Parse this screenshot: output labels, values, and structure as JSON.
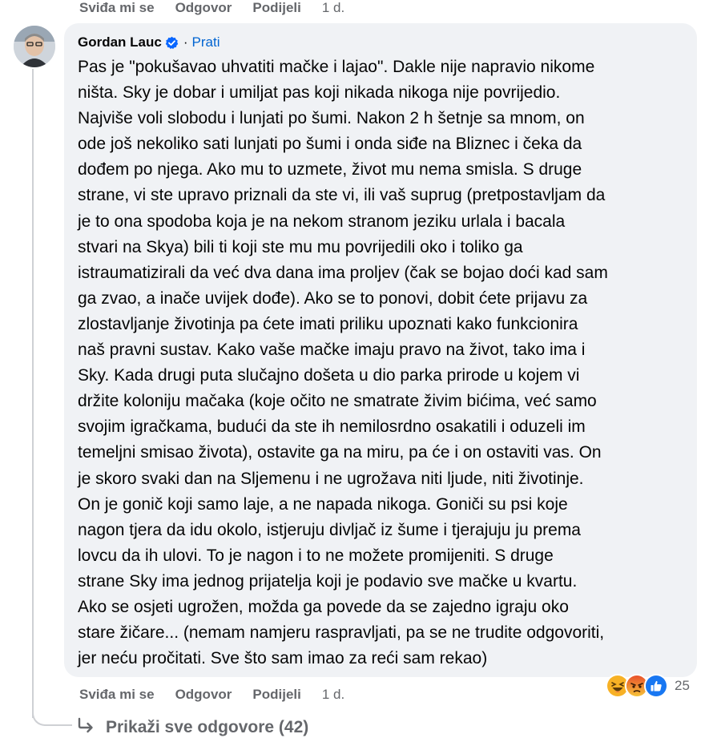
{
  "top_actions": {
    "like": "Sviđa mi se",
    "reply": "Odgovor",
    "share": "Podijeli",
    "time": "1 d."
  },
  "comment": {
    "author": "Gordan Lauc",
    "separator": "·",
    "follow": "Prati",
    "lines": [
      "Pas je \"pokušavao uhvatiti mačke i lajao\". Dakle nije napravio nikome",
      "ništa. Sky je dobar i umiljat pas koji nikada nikoga nije povrijedio.",
      "Najviše voli slobodu i lunjati po šumi. Nakon 2 h šetnje sa mnom, on",
      "ode još nekoliko sati lunjati po šumi i onda siđe na Bliznec i čeka da",
      "dođem po njega. Ako mu to uzmete, život mu nema smisla. S druge",
      "strane, vi ste upravo priznali da ste vi, ili vaš suprug (pretpostavljam da",
      "je to ona spodoba koja je na nekom stranom jeziku urlala i bacala",
      "stvari na Skya) bili ti koji ste mu mu povrijedili oko i toliko ga",
      "istraumatizirali da već dva dana ima proljev (čak se bojao doći kad sam",
      "ga zvao, a inače uvijek dođe). Ako se to ponovi, dobit ćete prijavu za",
      "zlostavljanje životinja pa ćete imati priliku upoznati kako funkcionira",
      "naš pravni sustav. Kako vaše mačke imaju pravo na život, tako ima i",
      "Sky. Kada drugi puta slučajno došeta u dio parka prirode u kojem vi",
      "držite koloniju mačaka (koje očito ne smatrate živim bićima, već samo",
      "svojim igračkama, budući da ste ih nemilosrdno osakatili i oduzeli im",
      "temeljni smisao života), ostavite ga na miru, pa će i on ostaviti vas. On",
      "je skoro svaki dan na Sljemenu i ne ugrožava niti ljude, niti životinje.",
      "On je gonič koji samo laje, a ne napada nikoga. Goniči su psi koje",
      "nagon tjera da idu okolo, istjeruju divljač iz šume i tjerajuju ju prema",
      "lovcu da ih ulovi. To je nagon i to ne možete promijeniti. S druge",
      "strane Sky ima jednog prijatelja koji je podavio sve mačke u kvartu.",
      "Ako se osjeti ugrožen, možda ga povede da se zajedno igraju oko",
      "stare žičare... (nemam namjeru raspravljati, pa se ne trudite odgovoriti,",
      "jer neću pročitati. Sve što sam imao za reći sam rekao)"
    ]
  },
  "bottom_actions": {
    "like": "Sviđa mi se",
    "reply": "Odgovor",
    "share": "Podijeli",
    "time": "1 d."
  },
  "reactions": {
    "icons": [
      "haha-icon",
      "angry-icon",
      "like-icon"
    ],
    "count": "25"
  },
  "show_replies": "Prikaži sve odgovore (42)",
  "colors": {
    "bubble": "#f0f2f5",
    "meta_text": "#65676b",
    "link": "#0064d1",
    "verified": "#0866ff"
  }
}
